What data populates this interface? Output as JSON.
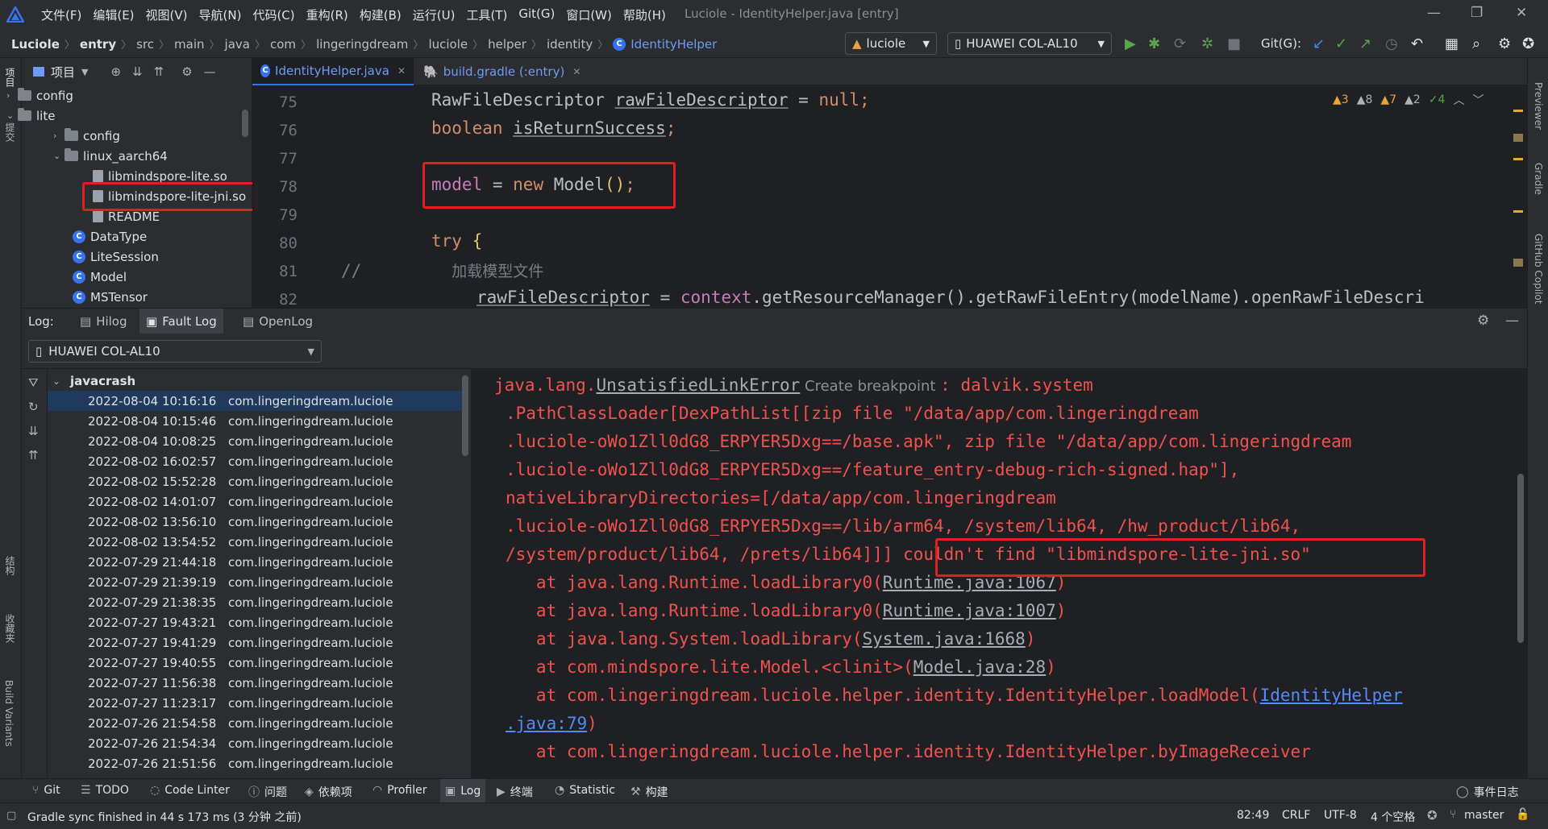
{
  "titlebar": {
    "menu": [
      "文件(F)",
      "编辑(E)",
      "视图(V)",
      "导航(N)",
      "代码(C)",
      "重构(R)",
      "构建(B)",
      "运行(U)",
      "工具(T)",
      "Git(G)",
      "窗口(W)",
      "帮助(H)"
    ],
    "window_title": "Luciole - IdentityHelper.java [entry]"
  },
  "navbar": {
    "breadcrumbs": [
      "Luciole",
      "entry",
      "src",
      "main",
      "java",
      "com",
      "lingeringdream",
      "luciole",
      "helper",
      "identity",
      "IdentityHelper"
    ],
    "run_config": "luciole",
    "device": "HUAWEI COL-AL10",
    "git_label": "Git(G):"
  },
  "left_strip": {
    "project": "项目",
    "commit": "提交",
    "structure": "结构",
    "favorites": "收藏夹",
    "build_variants": "Build Variants"
  },
  "right_strip": {
    "previewer": "Previewer",
    "gradle": "Gradle",
    "copilot": "GitHub Copilot"
  },
  "project_panel": {
    "title": "项目",
    "tree": [
      {
        "label": "config",
        "kind": "folder",
        "depth": 1,
        "expanded": false
      },
      {
        "label": "lite",
        "kind": "folder",
        "depth": 1,
        "expanded": true
      },
      {
        "label": "config",
        "kind": "folder",
        "depth": 2,
        "expanded": false
      },
      {
        "label": "linux_aarch64",
        "kind": "folder",
        "depth": 2,
        "expanded": true
      },
      {
        "label": "libmindspore-lite.so",
        "kind": "file",
        "depth": 3
      },
      {
        "label": "libmindspore-lite-jni.so",
        "kind": "file",
        "depth": 3
      },
      {
        "label": "README",
        "kind": "file",
        "depth": 3
      },
      {
        "label": "DataType",
        "kind": "class",
        "depth": 2
      },
      {
        "label": "LiteSession",
        "kind": "class",
        "depth": 2
      },
      {
        "label": "Model",
        "kind": "class",
        "depth": 2
      },
      {
        "label": "MSTensor",
        "kind": "class",
        "depth": 2
      }
    ]
  },
  "editor": {
    "tabs": [
      {
        "label": "IdentityHelper.java",
        "active": true
      },
      {
        "label": "build.gradle (:entry)",
        "active": false
      }
    ],
    "inspections": {
      "errors": "3",
      "warnings": "8",
      "weak": "7",
      "typos": "2",
      "ok": "4"
    },
    "line_numbers": [
      "75",
      "76",
      "77",
      "78",
      "79",
      "80",
      "81",
      "82"
    ],
    "lines": {
      "l75": {
        "type": "RawFileDescriptor",
        "var": "rawFileDescriptor",
        "eq": " = ",
        "val": "null",
        "end": ";"
      },
      "l76": {
        "type": "boolean",
        "var": "isReturnSuccess",
        "end": ";"
      },
      "l78": {
        "field": "model",
        "eq": " = ",
        "kw": "new",
        "cls": " Model",
        "paren": "()",
        "end": ";"
      },
      "l80": {
        "kw": "try",
        "brace": " {"
      },
      "l81": {
        "comment": "//",
        "text": "加载模型文件"
      },
      "l82": {
        "var": "rawFileDescriptor",
        "eq": " = ",
        "ctx": "context",
        "rest": ".getResourceManager().getRawFileEntry(modelName).openRawFileDescri"
      }
    }
  },
  "log_panel": {
    "label": "Log:",
    "tabs": [
      "Hilog",
      "Fault Log",
      "OpenLog"
    ],
    "active_tab": "Fault Log",
    "device": "HUAWEI COL-AL10",
    "group": "javacrash",
    "crashes": [
      {
        "time": "2022-08-04 10:16:16",
        "pkg": "com.lingeringdream.luciole"
      },
      {
        "time": "2022-08-04 10:15:46",
        "pkg": "com.lingeringdream.luciole"
      },
      {
        "time": "2022-08-04 10:08:25",
        "pkg": "com.lingeringdream.luciole"
      },
      {
        "time": "2022-08-02 16:02:57",
        "pkg": "com.lingeringdream.luciole"
      },
      {
        "time": "2022-08-02 15:52:28",
        "pkg": "com.lingeringdream.luciole"
      },
      {
        "time": "2022-08-02 14:01:07",
        "pkg": "com.lingeringdream.luciole"
      },
      {
        "time": "2022-08-02 13:56:10",
        "pkg": "com.lingeringdream.luciole"
      },
      {
        "time": "2022-08-02 13:54:52",
        "pkg": "com.lingeringdream.luciole"
      },
      {
        "time": "2022-07-29 21:44:18",
        "pkg": "com.lingeringdream.luciole"
      },
      {
        "time": "2022-07-29 21:39:19",
        "pkg": "com.lingeringdream.luciole"
      },
      {
        "time": "2022-07-29 21:38:35",
        "pkg": "com.lingeringdream.luciole"
      },
      {
        "time": "2022-07-27 19:43:21",
        "pkg": "com.lingeringdream.luciole"
      },
      {
        "time": "2022-07-27 19:41:29",
        "pkg": "com.lingeringdream.luciole"
      },
      {
        "time": "2022-07-27 19:40:55",
        "pkg": "com.lingeringdream.luciole"
      },
      {
        "time": "2022-07-27 11:56:38",
        "pkg": "com.lingeringdream.luciole"
      },
      {
        "time": "2022-07-27 11:23:17",
        "pkg": "com.lingeringdream.luciole"
      },
      {
        "time": "2022-07-26 21:54:58",
        "pkg": "com.lingeringdream.luciole"
      },
      {
        "time": "2022-07-26 21:54:34",
        "pkg": "com.lingeringdream.luciole"
      },
      {
        "time": "2022-07-26 21:51:56",
        "pkg": "com.lingeringdream.luciole"
      }
    ],
    "detail": {
      "l1_pre": "java.lang.",
      "l1_link": "UnsatisfiedLinkError",
      "l1_hint": " Create breakpoint ",
      "l1_post": ": dalvik.system",
      "l2": ".PathClassLoader[DexPathList[[zip file \"/data/app/com.lingeringdream",
      "l3": ".luciole-oWo1Zll0dG8_ERPYER5Dxg==/base.apk\", zip file \"/data/app/com.lingeringdream",
      "l4": ".luciole-oWo1Zll0dG8_ERPYER5Dxg==/feature_entry-debug-rich-signed.hap\"],",
      "l5": "nativeLibraryDirectories=[/data/app/com.lingeringdream",
      "l6": ".luciole-oWo1Zll0dG8_ERPYER5Dxg==/lib/arm64, /system/lib64, /hw_product/lib64,",
      "l7_pre": "/system/product/lib64, /prets/lib64]]] ",
      "l7_err": "couldn't find \"libmindspore-lite-jni.so\"",
      "l8_pre": "   at java.lang.Runtime.loadLibrary0(",
      "l8_link": "Runtime.java:1067",
      "l8_post": ")",
      "l9_pre": "   at java.lang.Runtime.loadLibrary0(",
      "l9_link": "Runtime.java:1007",
      "l9_post": ")",
      "l10_pre": "   at java.lang.System.loadLibrary(",
      "l10_link": "System.java:1668",
      "l10_post": ")",
      "l11_pre": "   at com.mindspore.lite.Model.<clinit>(",
      "l11_link": "Model.java:28",
      "l11_post": ")",
      "l12_pre": "   at com.lingeringdream.luciole.helper.identity.IdentityHelper.loadModel(",
      "l12_link": "IdentityHelper",
      "l13_link": ".java:79",
      "l13_post": ")",
      "l14": "   at com.lingeringdream.luciole.helper.identity.IdentityHelper.byImageReceiver"
    }
  },
  "bottom_tabs": [
    "Git",
    "TODO",
    "Code Linter",
    "问题",
    "依赖项",
    "Profiler",
    "Log",
    "终端",
    "Statistic",
    "构建"
  ],
  "event_log": "事件日志",
  "status": {
    "message": "Gradle sync finished in 44 s 173 ms (3 分钟 之前)",
    "position": "82:49",
    "line_sep": "CRLF",
    "encoding": "UTF-8",
    "indent": "4 个空格",
    "branch": "master"
  },
  "colors": {
    "error_red": "#f0524f",
    "accent_blue": "#3574f0",
    "highlight_box": "#e02020"
  }
}
